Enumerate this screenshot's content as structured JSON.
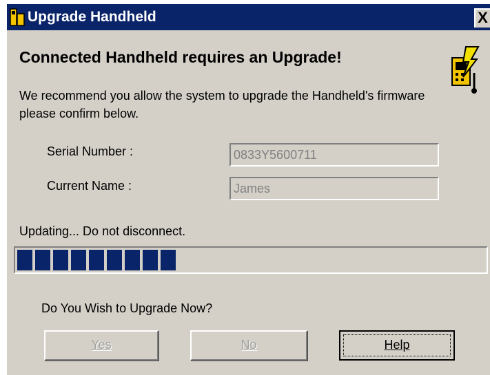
{
  "window": {
    "title": "Upgrade Handheld",
    "close_label": "X"
  },
  "dialog": {
    "heading": "Connected Handheld requires an Upgrade!",
    "description": "We recommend you allow the system to upgrade the Handheld's firmware please confirm below.",
    "icon": "handheld-lightning-icon"
  },
  "fields": {
    "serial": {
      "label": "Serial Number :",
      "value": "0833Y5600711"
    },
    "name": {
      "label": "Current Name :",
      "value": "James"
    }
  },
  "progress": {
    "status": "Updating... Do not disconnect.",
    "fraction": 0.35,
    "color": "#0a246a"
  },
  "prompt": {
    "question": "Do You Wish to Upgrade Now?"
  },
  "buttons": {
    "yes": "Yes",
    "no": "No",
    "help": "Help"
  }
}
